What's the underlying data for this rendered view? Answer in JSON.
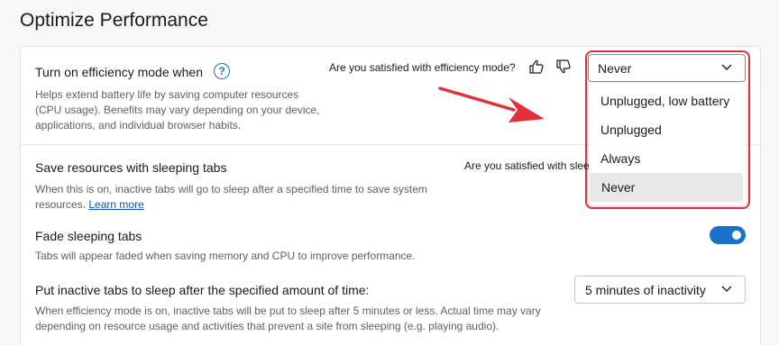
{
  "page": {
    "title": "Optimize Performance"
  },
  "efficiency": {
    "title": "Turn on efficiency mode when",
    "help_icon": "question-circle-icon",
    "desc_line1": "Helps extend battery life by saving computer resources",
    "desc_line2": "(CPU usage). Benefits may vary depending on your device,",
    "desc_line3": "applications, and individual browser habits.",
    "survey": "Are you satisfied with efficiency mode?",
    "thumbs_up_icon": "thumbs-up-icon",
    "thumbs_down_icon": "thumbs-down-icon",
    "selected": "Never",
    "options": [
      "Unplugged, low battery",
      "Unplugged",
      "Always",
      "Never"
    ]
  },
  "sleeping_tabs": {
    "title": "Save resources with sleeping tabs",
    "desc_line1": "When this is on, inactive tabs will go to sleep after a specified time to save system",
    "desc_line2": "resources.",
    "learn_more": "Learn more",
    "survey_partial": "Are you satisfied with slee"
  },
  "fade": {
    "title": "Fade sleeping tabs",
    "desc": "Tabs will appear faded when saving memory and CPU to improve performance.",
    "toggle_on": true
  },
  "inactive": {
    "title": "Put inactive tabs to sleep after the specified amount of time:",
    "desc_line1": "When efficiency mode is on, inactive tabs will be put to sleep after 5 minutes or less. Actual time may vary",
    "desc_line2": "depending on resource usage and activities that prevent a site from sleeping (e.g. playing audio).",
    "selected": "5 minutes of inactivity"
  },
  "colors": {
    "accent": "#1a73c8",
    "highlight": "#e0303a"
  }
}
